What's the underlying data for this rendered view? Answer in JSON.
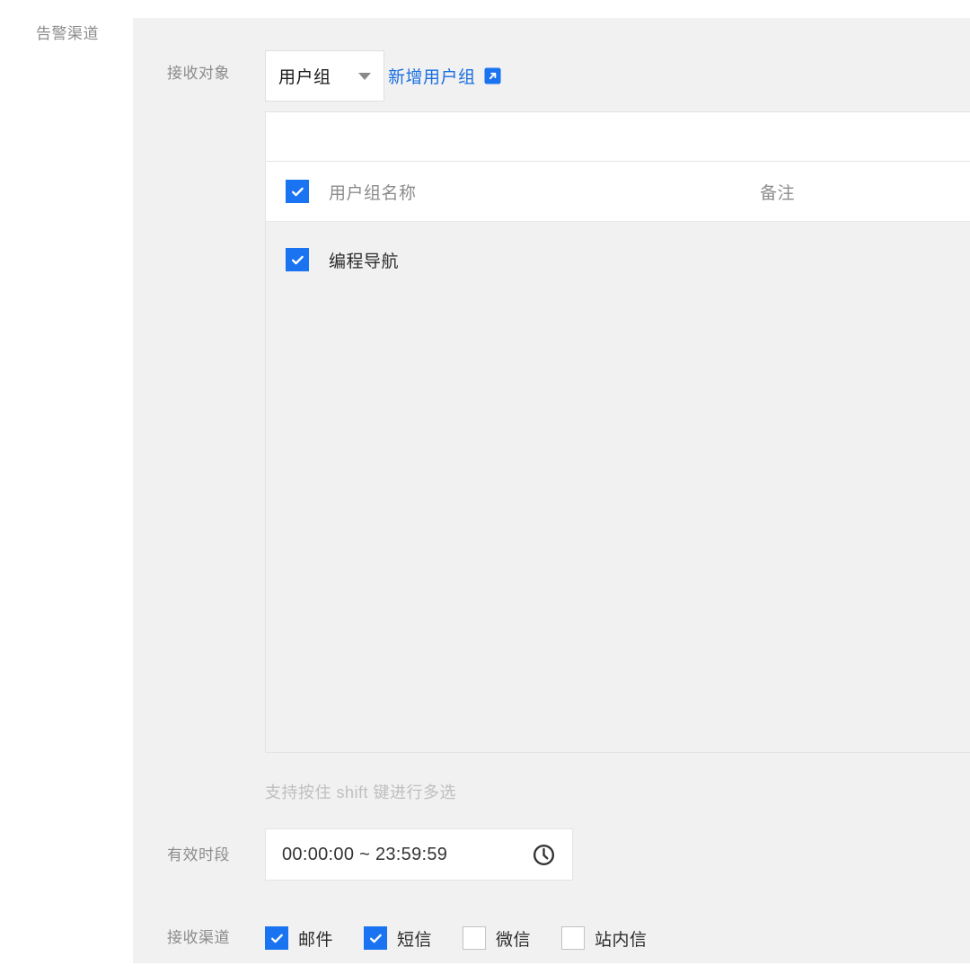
{
  "section": {
    "label": "告警渠道"
  },
  "receiver_row": {
    "label": "接收对象",
    "select": {
      "value": "用户组",
      "caret_icon": "chevron-down-icon"
    },
    "add_link": {
      "text": "新增用户组",
      "icon": "external-link-icon",
      "color": "#1a6fe0"
    }
  },
  "search": {
    "value": "",
    "placeholder": ""
  },
  "table": {
    "select_all_checked": true,
    "columns": [
      "用户组名称",
      "备注"
    ],
    "rows": [
      {
        "checked": true,
        "name": "编程导航",
        "note": ""
      }
    ]
  },
  "helper": {
    "text": "支持按住 shift 键进行多选"
  },
  "period_row": {
    "label": "有效时段",
    "value": "00:00:00 ~ 23:59:59",
    "icon": "clock-icon"
  },
  "channels_row": {
    "label": "接收渠道",
    "items": [
      {
        "label": "邮件",
        "checked": true
      },
      {
        "label": "短信",
        "checked": true
      },
      {
        "label": "微信",
        "checked": false
      },
      {
        "label": "站内信",
        "checked": false
      }
    ]
  },
  "colors": {
    "accent": "#1a73f0",
    "link": "#1a6fe0",
    "panel_bg": "#f1f1f1",
    "label_gray": "#8c8c8c"
  }
}
